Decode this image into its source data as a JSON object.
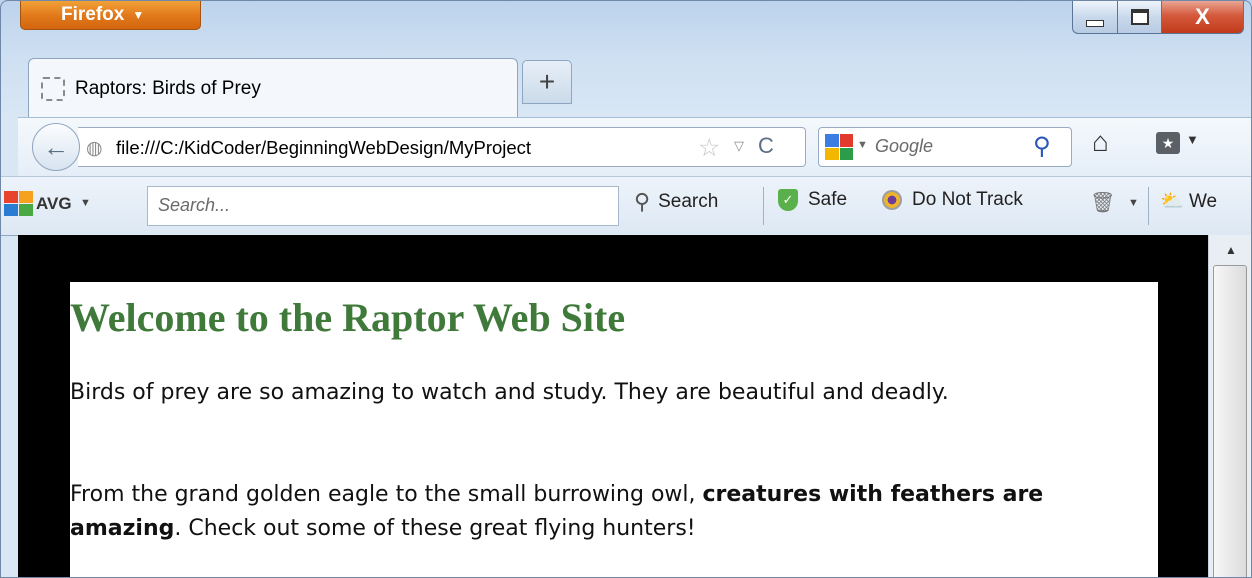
{
  "window": {
    "app_menu_label": "Firefox",
    "caption": {
      "minimize": "—",
      "maximize": "□",
      "close": "X"
    }
  },
  "tabs": [
    {
      "title": "Raptors: Birds of Prey"
    }
  ],
  "new_tab_label": "+",
  "navbar": {
    "url": "file:///C:/KidCoder/BeginningWebDesign/MyProject",
    "search_engine": "Google"
  },
  "avg_toolbar": {
    "brand": "AVG",
    "search_placeholder": "Search...",
    "search_button": "Search",
    "safe_label": "Safe",
    "dnt_label": "Do Not Track",
    "weather_label": "We"
  },
  "page": {
    "heading": "Welcome to the Raptor Web Site",
    "paragraph1": "Birds of prey are so amazing to watch and study. They are beautiful and deadly.",
    "paragraph2_start": "From the grand golden eagle to the small burrowing owl, ",
    "paragraph2_bold": "creatures with feathers are amazing",
    "paragraph2_end": ". Check out some of these great flying hunters!"
  },
  "colors": {
    "heading": "#3f7a3a",
    "firefox_button": "#e1781a",
    "close_button": "#c23a1c"
  }
}
